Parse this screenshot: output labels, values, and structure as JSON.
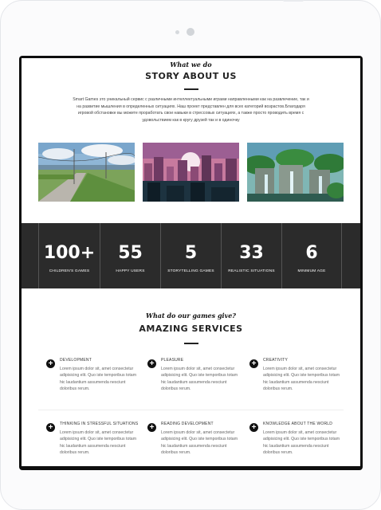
{
  "about": {
    "subtitle": "What we do",
    "title": "STORY ABOUT US",
    "description": "Smart Games это уникальный сервис с различными интеллектуальными играми направленными как на развлечение, так и на развитие мышления в определенных ситуациях. Наш проект представлен для всех категорий возрастов.Благодаря игровой обстановке вы можете проработать свои навыки в стрессовых ситуациях, а также просто проводить время с удовольствием как в кругу друзей так и в одиночку"
  },
  "stats": [
    {
      "value": "100+",
      "label": "CHILDREN'S GAMES"
    },
    {
      "value": "55",
      "label": "HAPPY USERS"
    },
    {
      "value": "5",
      "label": "STORYTELLING GAMES"
    },
    {
      "value": "33",
      "label": "REALISTIC SITUATIONS"
    },
    {
      "value": "6",
      "label": "MINIMUM AGE"
    }
  ],
  "services": {
    "subtitle": "What do our games give?",
    "title": "AMAZING SERVICES",
    "items": [
      {
        "title": "DEVELOPMENT",
        "text": "Lorem ipsum dolor sit, amet consectetur adipisicing elit. Quo iste temporibus totam hic laudantium assumenda nesciunt doloribus rerum."
      },
      {
        "title": "PLEASURE",
        "text": "Lorem ipsum dolor sit, amet consectetur adipisicing elit. Quo iste temporibus totam hic laudantium assumenda nesciunt doloribus rerum."
      },
      {
        "title": "CREATIVITY",
        "text": "Lorem ipsum dolor sit, amet consectetur adipisicing elit. Quo iste temporibus totam hic laudantium assumenda nesciunt doloribus rerum."
      },
      {
        "title": "THINKING IN STRESSFUL SITUATIONS",
        "text": "Lorem ipsum dolor sit, amet consectetur adipisicing elit. Quo iste temporibus totam hic laudantium assumenda nesciunt doloribus rerum."
      },
      {
        "title": "READING DEVELOPMENT",
        "text": "Lorem ipsum dolor sit, amet consectetur adipisicing elit. Quo iste temporibus totam hic laudantium assumenda nesciunt doloribus rerum."
      },
      {
        "title": "KNOWLEDGE ABOUT THE WORLD",
        "text": "Lorem ipsum dolor sit, amet consectetur adipisicing elit. Quo iste temporibus totam hic laudantium assumenda nesciunt doloribus rerum."
      }
    ],
    "icon": "plus-circle-icon"
  },
  "images": [
    "pixel-art-countryside-road-image",
    "pixel-art-city-sunset-image",
    "pixel-art-jungle-waterfall-image"
  ]
}
